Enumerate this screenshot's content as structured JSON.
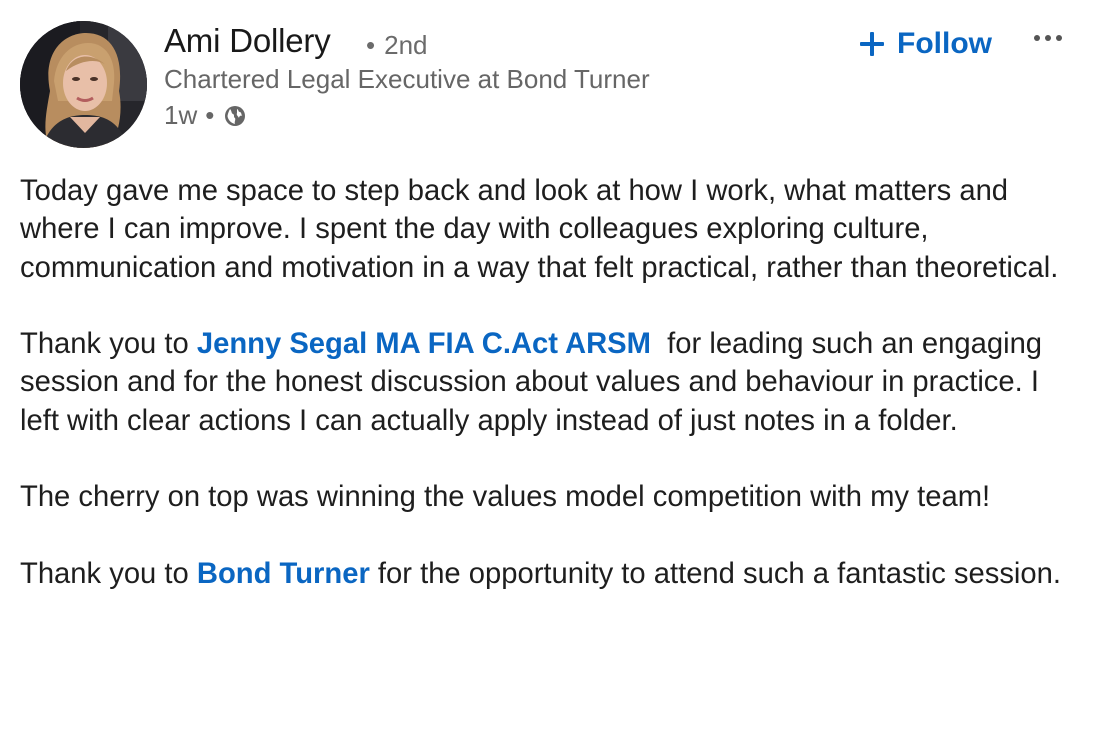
{
  "author": {
    "name": "Ami Dollery",
    "degree": "2nd",
    "headline": "Chartered Legal Executive at Bond Turner",
    "time": "1w",
    "visibility_icon": "globe-icon"
  },
  "actions": {
    "follow_label": "Follow",
    "follow_icon": "plus-icon",
    "more_icon": "more-horizontal-icon"
  },
  "colors": {
    "link": "#0a66c2",
    "text": "#1e1e1e",
    "secondary": "#666666"
  },
  "post": {
    "p1": "Today gave me space to step back and look at how I work, what matters and where I can improve. I spent the day with colleagues exploring culture, communication and motivation in a way that felt practical, rather than theoretical.",
    "p2_pre": "Thank you to ",
    "p2_mention": "Jenny Segal MA FIA C.Act ARSM",
    "p2_post": "  for leading such an engaging session and for the honest discussion about values and behaviour in practice. I left with clear actions I can actually apply instead of just notes in a folder.",
    "p3": "The cherry on top was winning the values model competition with my team!",
    "p4_pre": "Thank you to ",
    "p4_mention": "Bond Turner",
    "p4_post": " for the opportunity to attend such a fantastic session."
  }
}
